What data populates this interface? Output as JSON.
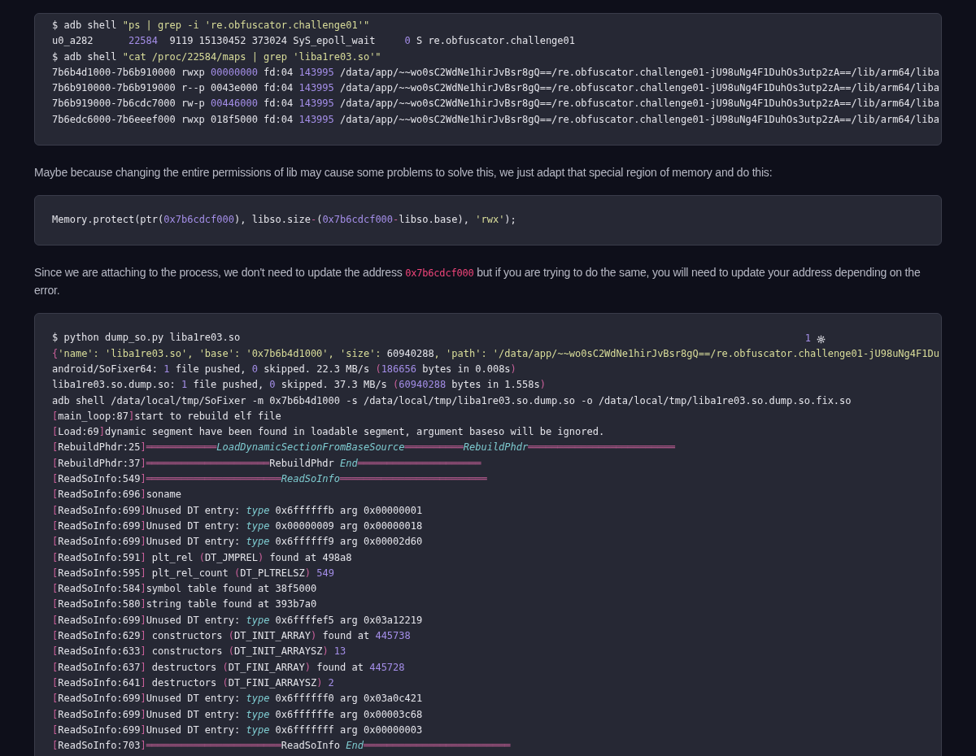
{
  "content": [
    {
      "kind": "code",
      "lines": [
        [
          {
            "kind": "plain",
            "text": "$ adb shell "
          },
          {
            "kind": "str",
            "text": "\"ps | grep -i 're.obfuscator.challenge01'\""
          }
        ],
        [
          {
            "kind": "plain",
            "text": "u0_a282      "
          },
          {
            "kind": "num",
            "text": "22584"
          },
          {
            "kind": "plain",
            "text": "  9119 15130452 373024 SyS_epoll_wait     "
          },
          {
            "kind": "num",
            "text": "0"
          },
          {
            "kind": "plain",
            "text": " S re.obfuscator.challenge01"
          }
        ],
        [
          {
            "kind": "plain",
            "text": "$ adb shell "
          },
          {
            "kind": "str",
            "text": "\"cat /proc/22584/maps | grep 'liba1re03.so'\""
          }
        ],
        [
          {
            "kind": "plain",
            "text": "7b6b4d1000-7b6b910000 rwxp "
          },
          {
            "kind": "num",
            "text": "00000000"
          },
          {
            "kind": "plain",
            "text": " fd:04 "
          },
          {
            "kind": "num",
            "text": "143995"
          },
          {
            "kind": "plain",
            "text": " /data/app/~~wo0sC2WdNe1hirJvBsr8gQ==/re.obfuscator.challenge01-jU98uNg4F1DuhOs3utp2zA==/lib/arm64/liba"
          }
        ],
        [
          {
            "kind": "plain",
            "text": "7b6b910000-7b6b919000 r--p 0043e000 fd:04 "
          },
          {
            "kind": "num",
            "text": "143995"
          },
          {
            "kind": "plain",
            "text": " /data/app/~~wo0sC2WdNe1hirJvBsr8gQ==/re.obfuscator.challenge01-jU98uNg4F1DuhOs3utp2zA==/lib/arm64/liba"
          }
        ],
        [
          {
            "kind": "plain",
            "text": "7b6b919000-7b6cdc7000 rw-p "
          },
          {
            "kind": "num",
            "text": "00446000"
          },
          {
            "kind": "plain",
            "text": " fd:04 "
          },
          {
            "kind": "num",
            "text": "143995"
          },
          {
            "kind": "plain",
            "text": " /data/app/~~wo0sC2WdNe1hirJvBsr8gQ==/re.obfuscator.challenge01-jU98uNg4F1DuhOs3utp2zA==/lib/arm64/liba"
          }
        ],
        [
          {
            "kind": "plain",
            "text": "7b6edc6000-7b6eeef000 rwxp 018f5000 fd:04 "
          },
          {
            "kind": "num",
            "text": "143995"
          },
          {
            "kind": "plain",
            "text": " /data/app/~~wo0sC2WdNe1hirJvBsr8gQ==/re.obfuscator.challenge01-jU98uNg4F1DuhOs3utp2zA==/lib/arm64/liba"
          }
        ]
      ]
    },
    {
      "kind": "paragraph",
      "parts": [
        {
          "kind": "text",
          "text": "Maybe because changing the entire permissions of lib may cause some problems to solve this, we just adapt that special region of memory and do this:"
        }
      ]
    },
    {
      "kind": "code",
      "lines": [
        [
          {
            "kind": "plain",
            "text": "Memory.protect(ptr("
          },
          {
            "kind": "num",
            "text": "0x7b6cdcf000"
          },
          {
            "kind": "plain",
            "text": "), libso.size"
          },
          {
            "kind": "punct",
            "text": "-"
          },
          {
            "kind": "plain",
            "text": "("
          },
          {
            "kind": "num",
            "text": "0x7b6cdcf000"
          },
          {
            "kind": "punct",
            "text": "-"
          },
          {
            "kind": "plain",
            "text": "libso.base), "
          },
          {
            "kind": "str",
            "text": "'rwx'"
          },
          {
            "kind": "plain",
            "text": ");"
          }
        ]
      ]
    },
    {
      "kind": "paragraph",
      "parts": [
        {
          "kind": "text",
          "text": "Since we are attaching to the process, we don't need to update the address "
        },
        {
          "kind": "code",
          "text": "0x7b6cdcf000"
        },
        {
          "kind": "text",
          "text": " but if you are trying to do the same, you will need to update your address depending on the error."
        }
      ]
    },
    {
      "kind": "code",
      "counter": "1",
      "lines": [
        [
          {
            "kind": "plain",
            "text": "$ python dump_so.py liba1re03.so"
          }
        ],
        [
          {
            "kind": "punct",
            "text": "{"
          },
          {
            "kind": "str",
            "text": "'name': 'liba1re03.so', 'base': '0x7b6b4d1000', 'size': "
          },
          {
            "kind": "plain",
            "text": "60940288"
          },
          {
            "kind": "str",
            "text": ", 'path': '/data/app/~~wo0sC2WdNe1hirJvBsr8gQ==/re.obfuscator.challenge01-jU98uNg4F1Du"
          }
        ],
        [
          {
            "kind": "plain",
            "text": "android/SoFixer64: "
          },
          {
            "kind": "num",
            "text": "1"
          },
          {
            "kind": "plain",
            "text": " file pushed, "
          },
          {
            "kind": "num",
            "text": "0"
          },
          {
            "kind": "plain",
            "text": " skipped. 22.3 MB/s "
          },
          {
            "kind": "punct",
            "text": "("
          },
          {
            "kind": "num",
            "text": "186656"
          },
          {
            "kind": "plain",
            "text": " bytes in 0.008s"
          },
          {
            "kind": "punct",
            "text": ")"
          }
        ],
        [
          {
            "kind": "plain",
            "text": "liba1re03.so.dump.so: "
          },
          {
            "kind": "num",
            "text": "1"
          },
          {
            "kind": "plain",
            "text": " file pushed, "
          },
          {
            "kind": "num",
            "text": "0"
          },
          {
            "kind": "plain",
            "text": " skipped. 37.3 MB/s "
          },
          {
            "kind": "punct",
            "text": "("
          },
          {
            "kind": "num",
            "text": "60940288"
          },
          {
            "kind": "plain",
            "text": " bytes in 1.558s"
          },
          {
            "kind": "punct",
            "text": ")"
          }
        ],
        [
          {
            "kind": "plain",
            "text": "adb shell /data/local/tmp/SoFixer -m 0x7b6b4d1000 -s /data/local/tmp/liba1re03.so.dump.so -o /data/local/tmp/liba1re03.so.dump.so.fix.so"
          }
        ],
        [
          {
            "kind": "punct",
            "text": "["
          },
          {
            "kind": "plain",
            "text": "main_loop:87"
          },
          {
            "kind": "punct",
            "text": "]"
          },
          {
            "kind": "plain",
            "text": "start to rebuild elf file"
          }
        ],
        [
          {
            "kind": "punct",
            "text": "["
          },
          {
            "kind": "plain",
            "text": "Load:69"
          },
          {
            "kind": "punct",
            "text": "]"
          },
          {
            "kind": "plain",
            "text": "dynamic segment have been found in loadable segment, argument baseso will be ignored."
          }
        ],
        [
          {
            "kind": "punct",
            "text": "["
          },
          {
            "kind": "plain",
            "text": "RebuildPhdr:25"
          },
          {
            "kind": "punct",
            "text": "]"
          },
          {
            "kind": "rule",
            "text": "════════════"
          },
          {
            "kind": "ital",
            "text": "LoadDynamicSectionFromBaseSource"
          },
          {
            "kind": "rule",
            "text": "══════════"
          },
          {
            "kind": "ital",
            "text": "RebuildPhdr"
          },
          {
            "kind": "rule",
            "text": "═════════════════════════"
          }
        ],
        [
          {
            "kind": "punct",
            "text": "["
          },
          {
            "kind": "plain",
            "text": "RebuildPhdr:37"
          },
          {
            "kind": "punct",
            "text": "]"
          },
          {
            "kind": "rule",
            "text": "═════════════════════"
          },
          {
            "kind": "plain",
            "text": "RebuildPhdr "
          },
          {
            "kind": "ital",
            "text": "End"
          },
          {
            "kind": "rule",
            "text": "═════════════════════"
          }
        ],
        [
          {
            "kind": "punct",
            "text": "["
          },
          {
            "kind": "plain",
            "text": "ReadSoInfo:549"
          },
          {
            "kind": "punct",
            "text": "]"
          },
          {
            "kind": "rule",
            "text": "═══════════════════════"
          },
          {
            "kind": "ital",
            "text": "ReadSoInfo"
          },
          {
            "kind": "rule",
            "text": "═════════════════════════"
          }
        ],
        [
          {
            "kind": "punct",
            "text": "["
          },
          {
            "kind": "plain",
            "text": "ReadSoInfo:696"
          },
          {
            "kind": "punct",
            "text": "]"
          },
          {
            "kind": "plain",
            "text": "soname"
          }
        ],
        [
          {
            "kind": "punct",
            "text": "["
          },
          {
            "kind": "plain",
            "text": "ReadSoInfo:699"
          },
          {
            "kind": "punct",
            "text": "]"
          },
          {
            "kind": "plain",
            "text": "Unused DT entry: "
          },
          {
            "kind": "ital",
            "text": "type"
          },
          {
            "kind": "plain",
            "text": " 0x6ffffffb arg 0x00000001"
          }
        ],
        [
          {
            "kind": "punct",
            "text": "["
          },
          {
            "kind": "plain",
            "text": "ReadSoInfo:699"
          },
          {
            "kind": "punct",
            "text": "]"
          },
          {
            "kind": "plain",
            "text": "Unused DT entry: "
          },
          {
            "kind": "ital",
            "text": "type"
          },
          {
            "kind": "plain",
            "text": " 0x00000009 arg 0x00000018"
          }
        ],
        [
          {
            "kind": "punct",
            "text": "["
          },
          {
            "kind": "plain",
            "text": "ReadSoInfo:699"
          },
          {
            "kind": "punct",
            "text": "]"
          },
          {
            "kind": "plain",
            "text": "Unused DT entry: "
          },
          {
            "kind": "ital",
            "text": "type"
          },
          {
            "kind": "plain",
            "text": " 0x6ffffff9 arg 0x00002d60"
          }
        ],
        [
          {
            "kind": "punct",
            "text": "["
          },
          {
            "kind": "plain",
            "text": "ReadSoInfo:591"
          },
          {
            "kind": "punct",
            "text": "]"
          },
          {
            "kind": "plain",
            "text": " plt_rel "
          },
          {
            "kind": "punct",
            "text": "("
          },
          {
            "kind": "plain",
            "text": "DT_JMPREL"
          },
          {
            "kind": "punct",
            "text": ")"
          },
          {
            "kind": "plain",
            "text": " found at 498a8"
          }
        ],
        [
          {
            "kind": "punct",
            "text": "["
          },
          {
            "kind": "plain",
            "text": "ReadSoInfo:595"
          },
          {
            "kind": "punct",
            "text": "]"
          },
          {
            "kind": "plain",
            "text": " plt_rel_count "
          },
          {
            "kind": "punct",
            "text": "("
          },
          {
            "kind": "plain",
            "text": "DT_PLTRELSZ"
          },
          {
            "kind": "punct",
            "text": ")"
          },
          {
            "kind": "num",
            "text": " 549"
          }
        ],
        [
          {
            "kind": "punct",
            "text": "["
          },
          {
            "kind": "plain",
            "text": "ReadSoInfo:584"
          },
          {
            "kind": "punct",
            "text": "]"
          },
          {
            "kind": "plain",
            "text": "symbol table found at 38f5000"
          }
        ],
        [
          {
            "kind": "punct",
            "text": "["
          },
          {
            "kind": "plain",
            "text": "ReadSoInfo:580"
          },
          {
            "kind": "punct",
            "text": "]"
          },
          {
            "kind": "plain",
            "text": "string table found at 393b7a0"
          }
        ],
        [
          {
            "kind": "punct",
            "text": "["
          },
          {
            "kind": "plain",
            "text": "ReadSoInfo:699"
          },
          {
            "kind": "punct",
            "text": "]"
          },
          {
            "kind": "plain",
            "text": "Unused DT entry: "
          },
          {
            "kind": "ital",
            "text": "type"
          },
          {
            "kind": "plain",
            "text": " 0x6ffffef5 arg 0x03a12219"
          }
        ],
        [
          {
            "kind": "punct",
            "text": "["
          },
          {
            "kind": "plain",
            "text": "ReadSoInfo:629"
          },
          {
            "kind": "punct",
            "text": "]"
          },
          {
            "kind": "plain",
            "text": " constructors "
          },
          {
            "kind": "punct",
            "text": "("
          },
          {
            "kind": "plain",
            "text": "DT_INIT_ARRAY"
          },
          {
            "kind": "punct",
            "text": ")"
          },
          {
            "kind": "plain",
            "text": " found at "
          },
          {
            "kind": "num",
            "text": "445738"
          }
        ],
        [
          {
            "kind": "punct",
            "text": "["
          },
          {
            "kind": "plain",
            "text": "ReadSoInfo:633"
          },
          {
            "kind": "punct",
            "text": "]"
          },
          {
            "kind": "plain",
            "text": " constructors "
          },
          {
            "kind": "punct",
            "text": "("
          },
          {
            "kind": "plain",
            "text": "DT_INIT_ARRAYSZ"
          },
          {
            "kind": "punct",
            "text": ")"
          },
          {
            "kind": "num",
            "text": " 13"
          }
        ],
        [
          {
            "kind": "punct",
            "text": "["
          },
          {
            "kind": "plain",
            "text": "ReadSoInfo:637"
          },
          {
            "kind": "punct",
            "text": "]"
          },
          {
            "kind": "plain",
            "text": " destructors "
          },
          {
            "kind": "punct",
            "text": "("
          },
          {
            "kind": "plain",
            "text": "DT_FINI_ARRAY"
          },
          {
            "kind": "punct",
            "text": ")"
          },
          {
            "kind": "plain",
            "text": " found at "
          },
          {
            "kind": "num",
            "text": "445728"
          }
        ],
        [
          {
            "kind": "punct",
            "text": "["
          },
          {
            "kind": "plain",
            "text": "ReadSoInfo:641"
          },
          {
            "kind": "punct",
            "text": "]"
          },
          {
            "kind": "plain",
            "text": " destructors "
          },
          {
            "kind": "punct",
            "text": "("
          },
          {
            "kind": "plain",
            "text": "DT_FINI_ARRAYSZ"
          },
          {
            "kind": "punct",
            "text": ")"
          },
          {
            "kind": "num",
            "text": " 2"
          }
        ],
        [
          {
            "kind": "punct",
            "text": "["
          },
          {
            "kind": "plain",
            "text": "ReadSoInfo:699"
          },
          {
            "kind": "punct",
            "text": "]"
          },
          {
            "kind": "plain",
            "text": "Unused DT entry: "
          },
          {
            "kind": "ital",
            "text": "type"
          },
          {
            "kind": "plain",
            "text": " 0x6ffffff0 arg 0x03a0c421"
          }
        ],
        [
          {
            "kind": "punct",
            "text": "["
          },
          {
            "kind": "plain",
            "text": "ReadSoInfo:699"
          },
          {
            "kind": "punct",
            "text": "]"
          },
          {
            "kind": "plain",
            "text": "Unused DT entry: "
          },
          {
            "kind": "ital",
            "text": "type"
          },
          {
            "kind": "plain",
            "text": " 0x6ffffffe arg 0x00003c68"
          }
        ],
        [
          {
            "kind": "punct",
            "text": "["
          },
          {
            "kind": "plain",
            "text": "ReadSoInfo:699"
          },
          {
            "kind": "punct",
            "text": "]"
          },
          {
            "kind": "plain",
            "text": "Unused DT entry: "
          },
          {
            "kind": "ital",
            "text": "type"
          },
          {
            "kind": "plain",
            "text": " 0x6fffffff arg 0x00000003"
          }
        ],
        [
          {
            "kind": "punct",
            "text": "["
          },
          {
            "kind": "plain",
            "text": "ReadSoInfo:703"
          },
          {
            "kind": "punct",
            "text": "]"
          },
          {
            "kind": "rule",
            "text": "═══════════════════════"
          },
          {
            "kind": "plain",
            "text": "ReadSoInfo "
          },
          {
            "kind": "ital",
            "text": "End"
          },
          {
            "kind": "rule",
            "text": "═════════════════════════"
          }
        ]
      ]
    }
  ]
}
